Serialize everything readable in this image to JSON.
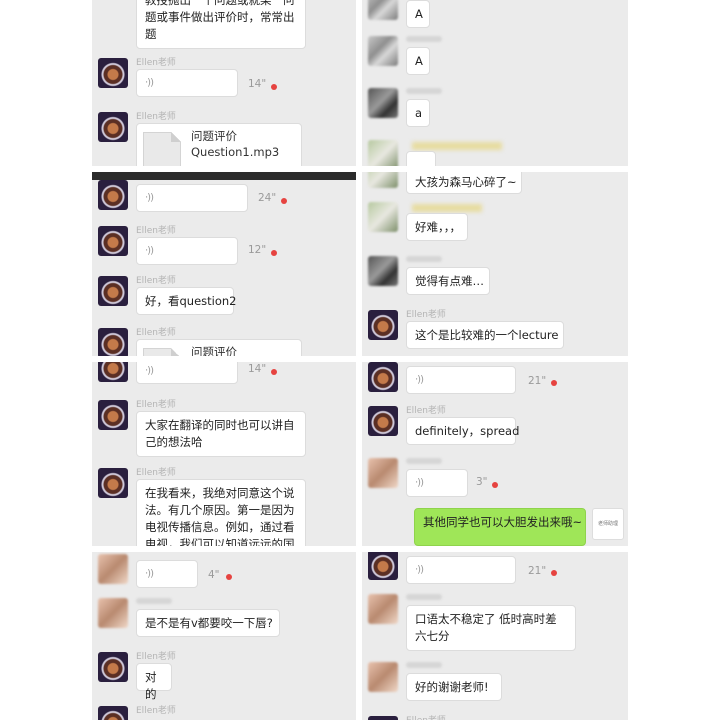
{
  "teacher_name": "Ellen老师",
  "p1": {
    "partial_text": "教授抛出一个问题或就某一问题或事件做出评价时，常常出题",
    "voice1_duration": "14\"",
    "file_title": "问题评价",
    "file_name": "Question1.mp3"
  },
  "p2": {
    "voice1_duration": "24\"",
    "voice2_duration": "12\"",
    "text1": "好，看question2",
    "file_partial": "问题评价"
  },
  "p3": {
    "voice1_duration": "14\"",
    "text1": "大家在翻译的同时也可以讲自己的想法哈",
    "text2": "在我看来，我绝对同意这个说法。有几个原因。第一是因为电视传播信息。例如，通过看电视，我们可以知道远远的国家"
  },
  "p4": {
    "voice1_duration": "4\"",
    "text1": "是不是有v都要咬一下唇?",
    "text2": "对的"
  },
  "p5": {
    "text1": "A",
    "text2": "A",
    "text3": "a"
  },
  "p6": {
    "text1": "大孩为森马心碎了~",
    "text2": "好难，，，",
    "text3": "觉得有点难…",
    "text4": "这个是比较难的一个lecture"
  },
  "p7": {
    "voice1_duration": "21\"",
    "text1": "definitely，spread",
    "voice2_duration": "3\"",
    "text2": "其他同学也可以大胆发出来哦~",
    "logo_text": "老师助理"
  },
  "p8": {
    "voice1_duration": "21\"",
    "text1": "口语太不稳定了 低时高时差六七分",
    "text2": "好的谢谢老师!"
  },
  "colors": {
    "panel_bg": "#ebebeb",
    "bubble_bg": "#ffffff",
    "self_bubble": "#9fe658",
    "unread_dot": "#e64340",
    "meta_text": "#b4b4b4"
  }
}
